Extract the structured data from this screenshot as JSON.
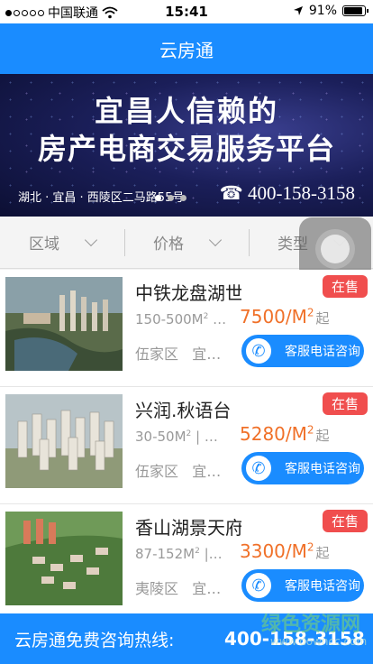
{
  "status_bar": {
    "carrier": "中国联通",
    "time": "15:41",
    "battery": "91%"
  },
  "header": {
    "title": "云房通"
  },
  "banner": {
    "headline": "宜昌人信赖的",
    "subheadline": "房产电商交易服务平台",
    "address": "湖北 · 宜昌 · 西陵区二马路55号",
    "phone": "☎ 400-158-3158"
  },
  "filters": [
    {
      "label": "区域"
    },
    {
      "label": "价格"
    },
    {
      "label": "类型"
    }
  ],
  "listings": [
    {
      "name": "中铁龙盘湖世",
      "area": "150-500M",
      "area_suffix": "…",
      "price": "7500/M",
      "price_unit": "起",
      "district": "伍家区",
      "district_suffix": "宜…",
      "badge": "在售",
      "call_label": "客服电话咨询"
    },
    {
      "name": "兴润.秋语台",
      "area": "30-50M",
      "area_suffix": "|  …",
      "price": "5280/M",
      "price_unit": "起",
      "district": "伍家区",
      "district_suffix": "宜…",
      "badge": "在售",
      "call_label": "客服电话咨询"
    },
    {
      "name": "香山湖景天府",
      "area": "87-152M",
      "area_suffix": "|…",
      "price": "3300/M",
      "price_unit": "起",
      "district": "夷陵区",
      "district_suffix": "宜…",
      "badge": "在售",
      "call_label": "客服电话咨询"
    }
  ],
  "footer": {
    "text": "云房通免费咨询热线:",
    "phone": "400-158-3158"
  },
  "watermark": {
    "text": "绿色资源网",
    "url": "www.downcc.com"
  }
}
